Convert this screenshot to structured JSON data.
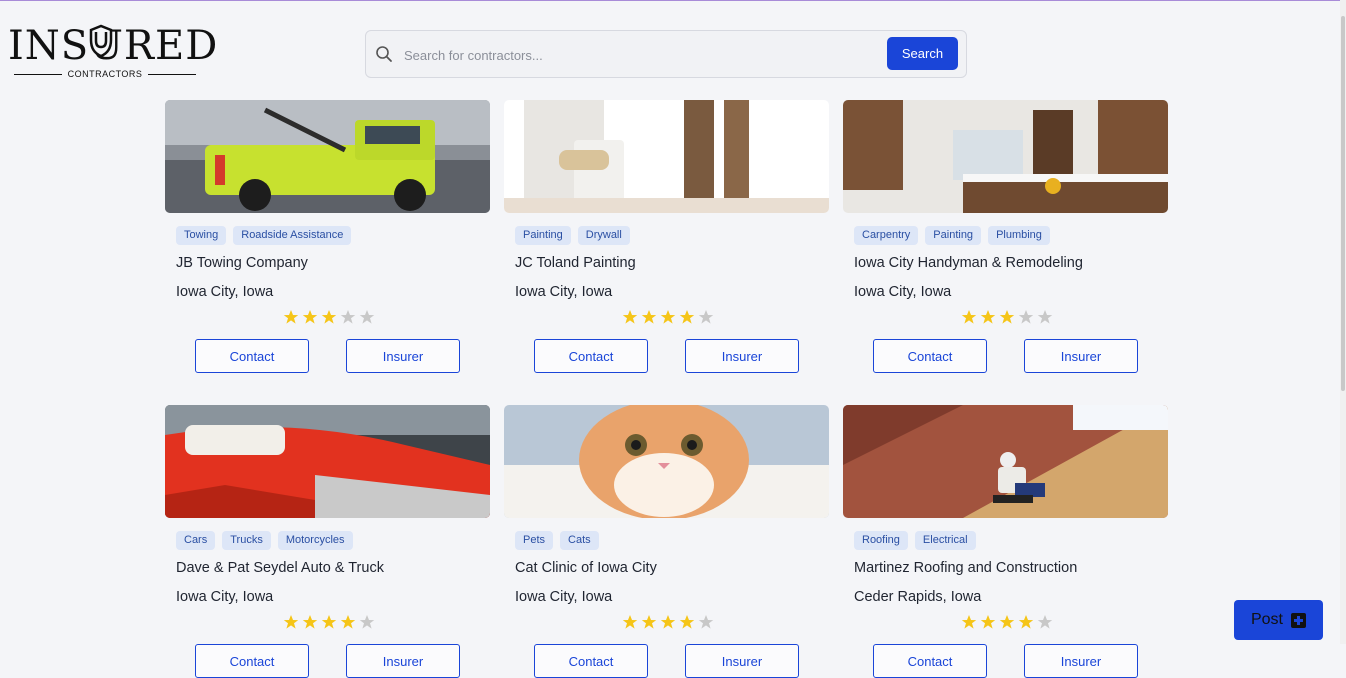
{
  "brand": {
    "logo_word": "INSURED",
    "logo_sub": "CONTRACTORS"
  },
  "search": {
    "placeholder": "Search for contractors...",
    "value": "",
    "button_label": "Search"
  },
  "post_button": {
    "label": "Post",
    "icon": "plus-square-icon"
  },
  "colors": {
    "accent": "#1a45d8",
    "tag_bg": "#dde6f7",
    "star": "#f5c518",
    "star_empty": "#c8c8c8"
  },
  "contractors": [
    {
      "tags": [
        "Towing",
        "Roadside Assistance"
      ],
      "name": "JB Towing Company",
      "location": "Iowa City, Iowa",
      "rating": 3,
      "max_rating": 5,
      "image": "tow-truck-photo",
      "contact_label": "Contact",
      "insurer_label": "Insurer"
    },
    {
      "tags": [
        "Painting",
        "Drywall"
      ],
      "name": "JC Toland Painting",
      "location": "Iowa City, Iowa",
      "rating": 4,
      "max_rating": 5,
      "image": "painter-photo",
      "contact_label": "Contact",
      "insurer_label": "Insurer"
    },
    {
      "tags": [
        "Carpentry",
        "Painting",
        "Plumbing"
      ],
      "name": "Iowa City Handyman & Remodeling",
      "location": "Iowa City, Iowa",
      "rating": 3,
      "max_rating": 5,
      "image": "kitchen-photo",
      "contact_label": "Contact",
      "insurer_label": "Insurer"
    },
    {
      "tags": [
        "Cars",
        "Trucks",
        "Motorcycles"
      ],
      "name": "Dave & Pat Seydel Auto & Truck",
      "location": "Iowa City, Iowa",
      "rating": 4,
      "max_rating": 5,
      "image": "red-car-photo",
      "contact_label": "Contact",
      "insurer_label": "Insurer"
    },
    {
      "tags": [
        "Pets",
        "Cats"
      ],
      "name": "Cat Clinic of Iowa City",
      "location": "Iowa City, Iowa",
      "rating": 4,
      "max_rating": 5,
      "image": "cat-photo",
      "contact_label": "Contact",
      "insurer_label": "Insurer"
    },
    {
      "tags": [
        "Roofing",
        "Electrical"
      ],
      "name": "Martinez Roofing and Construction",
      "location": "Ceder Rapids, Iowa",
      "rating": 4,
      "max_rating": 5,
      "image": "roofer-photo",
      "contact_label": "Contact",
      "insurer_label": "Insurer"
    }
  ]
}
